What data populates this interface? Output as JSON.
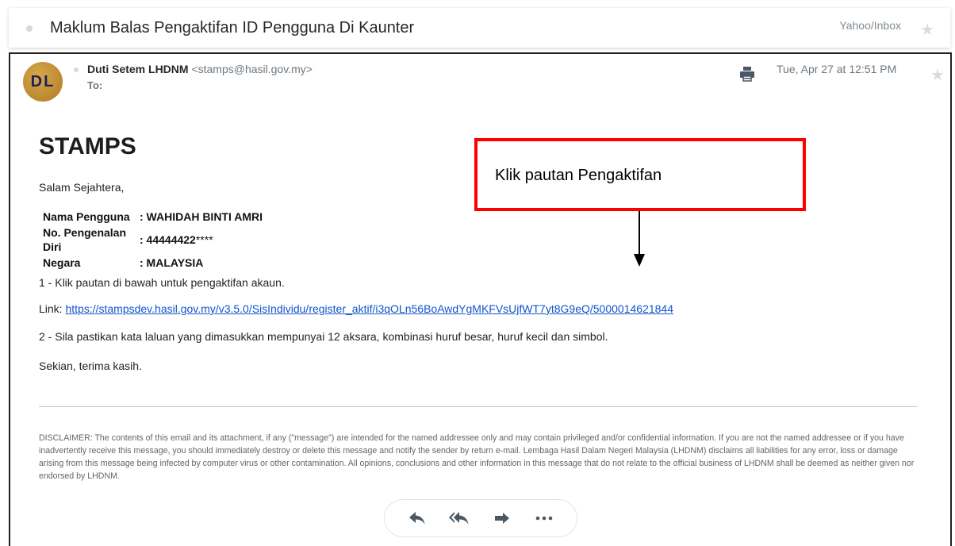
{
  "subject": {
    "title": "Maklum Balas Pengaktifan ID Pengguna Di Kaunter",
    "folder": "Yahoo/Inbox"
  },
  "header": {
    "avatar_initials": "DL",
    "sender_name": "Duti Setem LHDNM",
    "sender_email": "<stamps@hasil.gov.my>",
    "to_label": "To:",
    "date": "Tue, Apr 27 at 12:51 PM"
  },
  "body": {
    "title": "STAMPS",
    "greeting": "Salam Sejahtera,",
    "info": [
      {
        "label": "Nama Pengguna",
        "value": ": WAHIDAH BINTI AMRI",
        "suffix": ""
      },
      {
        "label": "No. Pengenalan Diri",
        "value": ": 44444422",
        "suffix": "****"
      },
      {
        "label": "Negara",
        "value": ": MALAYSIA",
        "suffix": ""
      }
    ],
    "step1": "1 - Klik pautan di bawah untuk pengaktifan akaun.",
    "link_prefix": "Link: ",
    "link_url": "https://stampsdev.hasil.gov.my/v3.5.0/SisIndividu/register_aktif/i3qOLn56BoAwdYgMKFVsUjfWT7yt8G9eQ/5000014621844",
    "step2": "2 - Sila pastikan kata laluan yang dimasukkan mempunyai 12 aksara, kombinasi huruf besar, huruf kecil dan simbol.",
    "closing": "Sekian, terima kasih.",
    "disclaimer": "DISCLAIMER: The contents of this email and its attachment, if any (\"message\") are intended for the named addressee only and may contain privileged and/or confidential information. If you are not the named addressee or if you have inadvertently receive this message, you should immediately destroy or delete this message and notify the sender by return e-mail. Lembaga Hasil Dalam Negeri Malaysia (LHDNM) disclaims all liabilities for any error, loss or damage arising from this message being infected by computer virus or other contamination. All opinions, conclusions and other information in this message that do not relate to the official business of LHDNM shall be deemed as neither given nor endorsed by LHDNM."
  },
  "annotation": {
    "callout_text": "Klik pautan Pengaktifan",
    "border_color": "#ff0000"
  },
  "actions": {
    "icons": [
      "reply-icon",
      "reply-all-icon",
      "forward-icon",
      "more-icon"
    ]
  },
  "colors": {
    "link": "#1155cc",
    "icon": "#4a5866"
  }
}
